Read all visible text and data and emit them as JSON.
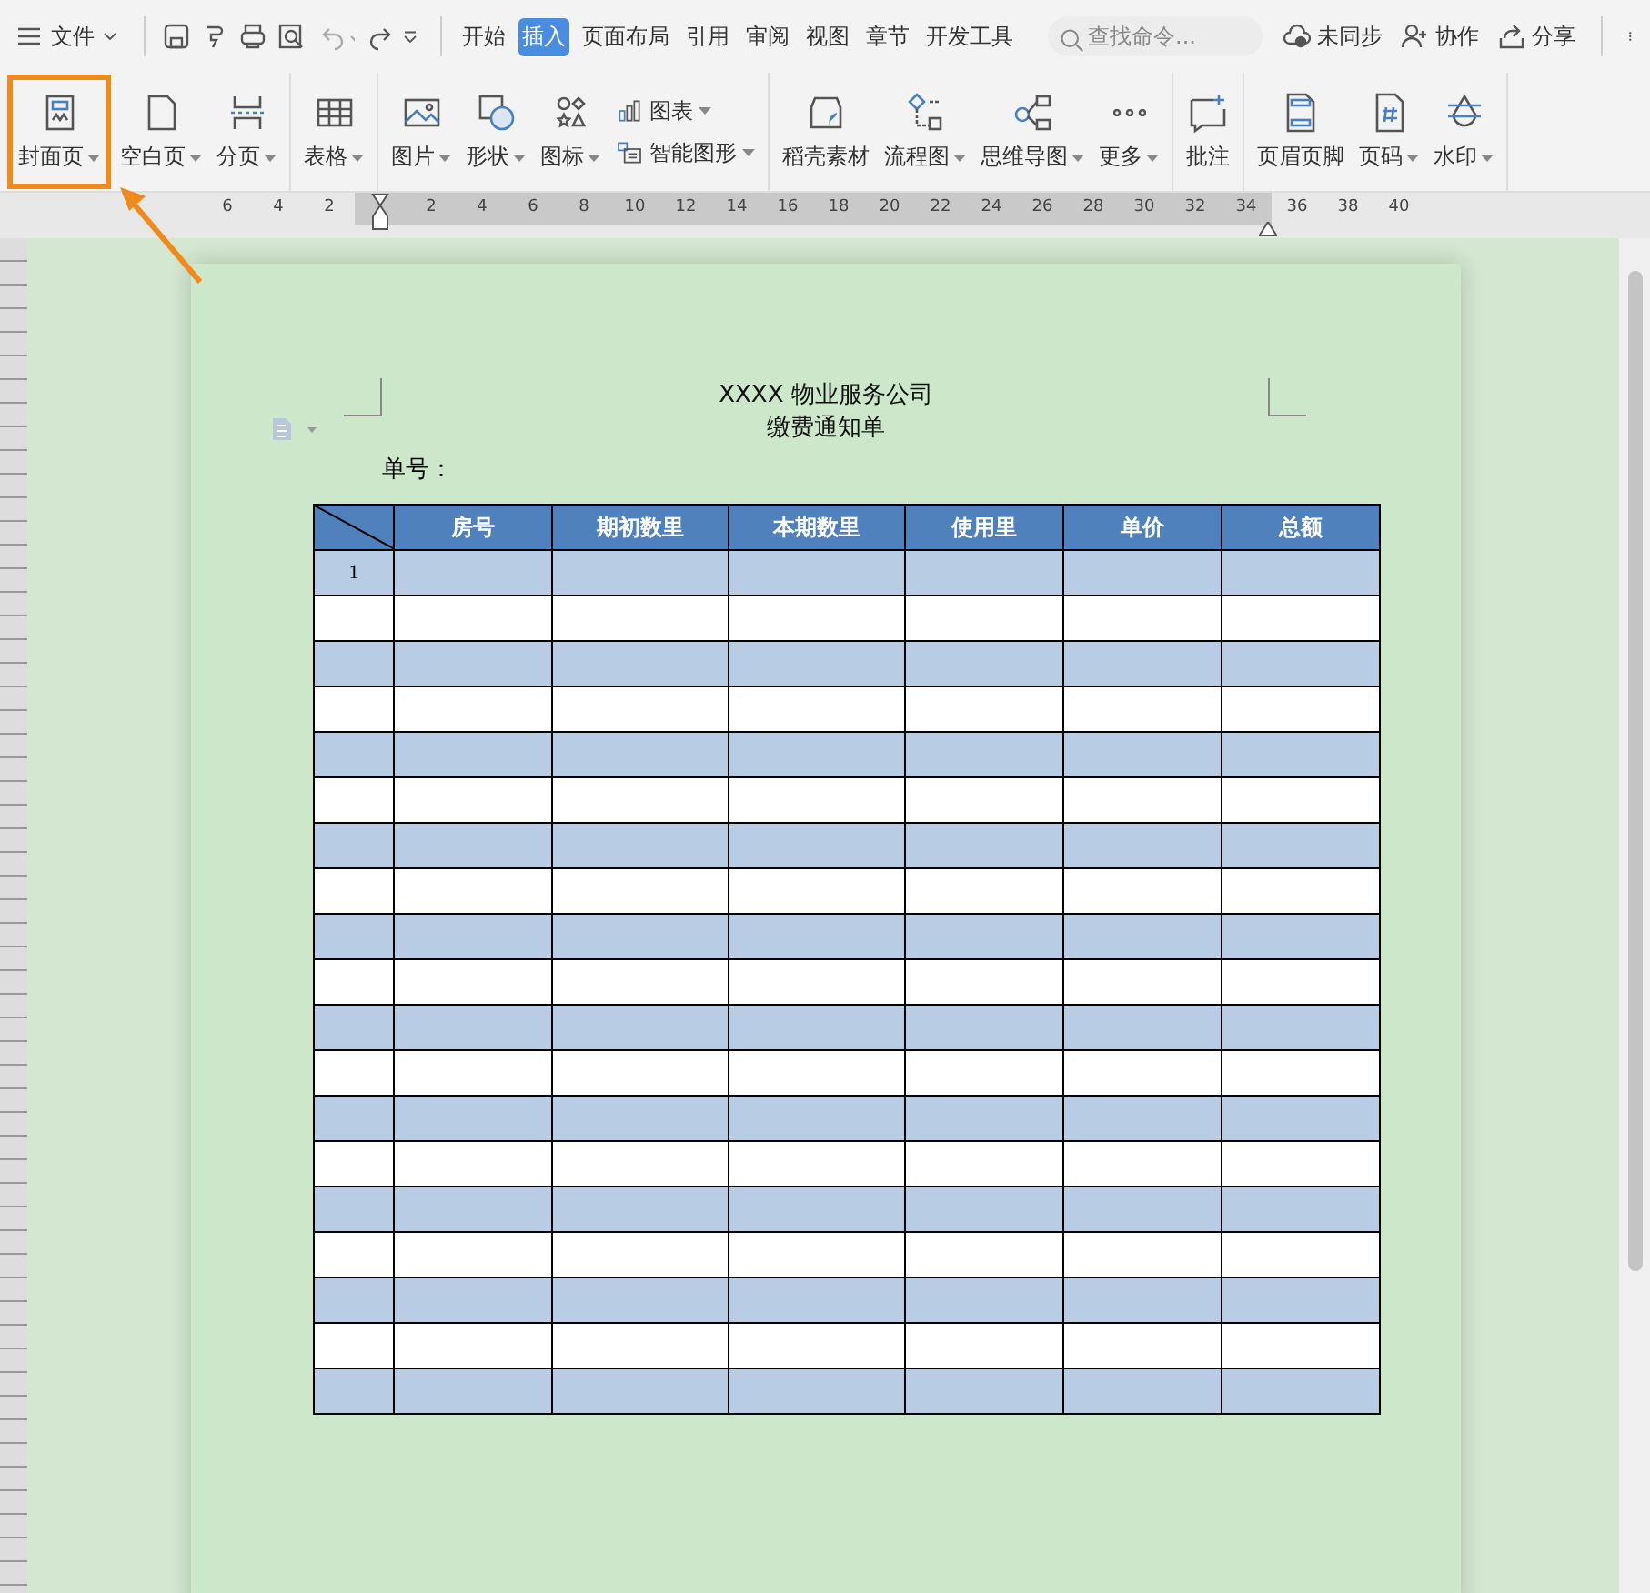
{
  "menu": {
    "label": "文件"
  },
  "tabs": [
    {
      "label": "开始",
      "selected": false
    },
    {
      "label": "插入",
      "selected": true
    },
    {
      "label": "页面布局",
      "selected": false
    },
    {
      "label": "引用",
      "selected": false
    },
    {
      "label": "审阅",
      "selected": false
    },
    {
      "label": "视图",
      "selected": false
    },
    {
      "label": "章节",
      "selected": false
    },
    {
      "label": "开发工具",
      "selected": false
    }
  ],
  "search": {
    "placeholder": "查找命令..."
  },
  "account_actions": [
    {
      "label": "未同步"
    },
    {
      "label": "协作"
    },
    {
      "label": "分享"
    }
  ],
  "ribbon": {
    "groups": [
      {
        "items": [
          {
            "kind": "large",
            "label": "封面页",
            "dropdown": true,
            "highlighted": true
          },
          {
            "kind": "large",
            "label": "空白页",
            "dropdown": true,
            "highlighted": false
          },
          {
            "kind": "large",
            "label": "分页",
            "dropdown": true,
            "highlighted": false
          }
        ]
      },
      {
        "items": [
          {
            "kind": "large",
            "label": "表格",
            "dropdown": true,
            "highlighted": false
          }
        ]
      },
      {
        "items": [
          {
            "kind": "large",
            "label": "图片",
            "dropdown": true,
            "highlighted": false
          },
          {
            "kind": "large",
            "label": "形状",
            "dropdown": true,
            "highlighted": false
          },
          {
            "kind": "large",
            "label": "图标",
            "dropdown": true,
            "highlighted": false
          },
          {
            "kind": "small",
            "label": "图表",
            "dropdown": true,
            "highlighted": false
          },
          {
            "kind": "small",
            "label": "智能图形",
            "dropdown": true,
            "highlighted": false
          }
        ]
      },
      {
        "items": [
          {
            "kind": "large",
            "label": "稻壳素材",
            "dropdown": false,
            "highlighted": false
          },
          {
            "kind": "large",
            "label": "流程图",
            "dropdown": true,
            "highlighted": false
          },
          {
            "kind": "large",
            "label": "思维导图",
            "dropdown": true,
            "highlighted": false
          },
          {
            "kind": "large",
            "label": "更多",
            "dropdown": true,
            "highlighted": false
          }
        ]
      },
      {
        "items": [
          {
            "kind": "large",
            "label": "批注",
            "dropdown": false,
            "highlighted": false
          }
        ]
      },
      {
        "items": [
          {
            "kind": "large",
            "label": "页眉页脚",
            "dropdown": false,
            "highlighted": false
          },
          {
            "kind": "large",
            "label": "页码",
            "dropdown": true,
            "highlighted": false
          },
          {
            "kind": "large",
            "label": "水印",
            "dropdown": true,
            "highlighted": false
          }
        ]
      }
    ]
  },
  "ruler": {
    "left_numbers": [
      "6",
      "4",
      "2"
    ],
    "numbers": [
      "2",
      "4",
      "6",
      "8",
      "10",
      "12",
      "14",
      "16",
      "18",
      "20",
      "22",
      "24",
      "26",
      "28",
      "30",
      "32",
      "34",
      "36",
      "38",
      "40"
    ]
  },
  "document": {
    "title": "XXXX 物业服务公司",
    "subtitle": "缴费通知单",
    "number_label": "单号：",
    "table": {
      "columns": [
        "房号",
        "期初数里",
        "本期数里",
        "使用里",
        "单价",
        "总额"
      ],
      "rows": [
        {
          "shaded": true,
          "index": "1"
        },
        {
          "shaded": false
        },
        {
          "shaded": true
        },
        {
          "shaded": false
        },
        {
          "shaded": true
        },
        {
          "shaded": false
        },
        {
          "shaded": true
        },
        {
          "shaded": false
        },
        {
          "shaded": true
        },
        {
          "shaded": false
        },
        {
          "shaded": true
        },
        {
          "shaded": false
        },
        {
          "shaded": true
        },
        {
          "shaded": false
        },
        {
          "shaded": true
        },
        {
          "shaded": false
        },
        {
          "shaded": true
        },
        {
          "shaded": false
        },
        {
          "shaded": true
        }
      ]
    }
  }
}
